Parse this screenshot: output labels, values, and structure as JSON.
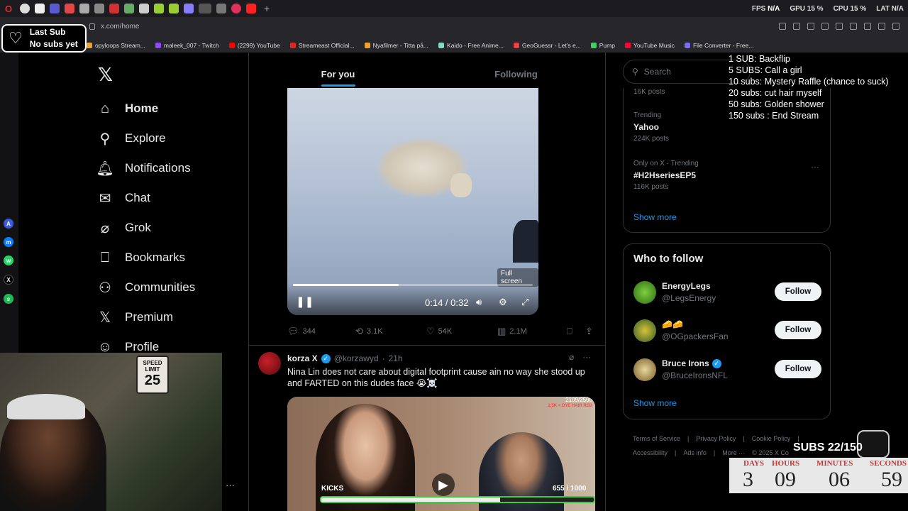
{
  "perf": {
    "fps_label": "FPS",
    "fps_val": "N/A",
    "gpu_label": "GPU",
    "gpu_val": "15 %",
    "cpu_label": "CPU",
    "cpu_val": "15 %",
    "lat_label": "LAT",
    "lat_val": "N/A"
  },
  "browser": {
    "url": "x.com/home"
  },
  "bookmarks": [
    {
      "label": "opyloops Stream...",
      "color": "#e8a33a"
    },
    {
      "label": "maleek_007 - Twitch",
      "color": "#9146ff"
    },
    {
      "label": "(2299) YouTube",
      "color": "#ff0000"
    },
    {
      "label": "Streameast Official...",
      "color": "#e02424"
    },
    {
      "label": "Nyafilmer - Titta på...",
      "color": "#f0a030"
    },
    {
      "label": "Kaido - Free Anime...",
      "color": "#7fdcc4"
    },
    {
      "label": "GeoGuessr - Let's e...",
      "color": "#e84040"
    },
    {
      "label": "Pump",
      "color": "#44cc66"
    },
    {
      "label": "YouTube Music",
      "color": "#ff0033"
    },
    {
      "label": "File Converter - Free...",
      "color": "#7a6cf0"
    }
  ],
  "last_sub": {
    "line1": "Last Sub",
    "line2": "No subs yet"
  },
  "nav": {
    "items": [
      {
        "label": "Home",
        "icon": "home-icon"
      },
      {
        "label": "Explore",
        "icon": "search-icon"
      },
      {
        "label": "Notifications",
        "icon": "bell-icon"
      },
      {
        "label": "Chat",
        "icon": "mail-icon"
      },
      {
        "label": "Grok",
        "icon": "grok-icon"
      },
      {
        "label": "Bookmarks",
        "icon": "bookmark-icon"
      },
      {
        "label": "Communities",
        "icon": "communities-icon"
      },
      {
        "label": "Premium",
        "icon": "x-icon"
      },
      {
        "label": "Profile",
        "icon": "person-icon"
      }
    ]
  },
  "tabs": {
    "for_you": "For you",
    "following": "Following"
  },
  "video": {
    "tooltip": "Full screen",
    "time": "0:14 / 0:32",
    "progress": 0.44
  },
  "tweet1": {
    "replies": "344",
    "reposts": "3.1K",
    "likes": "54K",
    "views": "2.1M"
  },
  "tweet2": {
    "name": "korza X",
    "handle": "@korzawyd",
    "time": "21h",
    "text": "Nina Lin does not care about digital footprint cause ain no way she stood up and FARTED on this dudes face 😭☠️",
    "media_top": "2109/2500",
    "media_red": "2.5K = DYE HAIR RED",
    "kicks_label": "KICKS",
    "kicks_count": "655 / 1000",
    "kicks_progress": 0.655
  },
  "right": {
    "search_placeholder": "Search",
    "trend0_posts": "16K posts",
    "trend1_meta": "Trending",
    "trend1_name": "Yahoo",
    "trend1_posts": "224K posts",
    "trend2_meta": "Only on X · Trending",
    "trend2_name": "#H2HseriesEP5",
    "trend2_posts": "116K posts",
    "show_more": "Show more",
    "who_to_follow": "Who to follow",
    "follow": [
      {
        "name": "EnergyLegs",
        "handle": "@LegsEnergy",
        "btn": "Follow"
      },
      {
        "name": "🧀🧀",
        "handle": "@OGpackersFan",
        "btn": "Follow"
      },
      {
        "name": "Bruce Irons",
        "handle": "@BruceIronsNFL",
        "btn": "Follow"
      }
    ],
    "show_more2": "Show more",
    "footer": [
      "Terms of Service",
      "|",
      "Privacy Policy",
      "|",
      "Cookie Policy",
      "|",
      "Accessibility",
      "|",
      "Ads info",
      "|",
      "More ···",
      "© 2025 X Co"
    ]
  },
  "overlay": {
    "goals": [
      "1 SUB: Backflip",
      "5 SUBS: Call a girl",
      "10 subs: Mystery Raffle (chance to suck)",
      "20 subs: cut hair myself",
      "50 subs: Golden shower",
      "150 subs : End Stream"
    ],
    "subs": "SUBS 22/150",
    "countdown": [
      {
        "label": "DAYS",
        "value": "3"
      },
      {
        "label": "HOURS",
        "value": "09"
      },
      {
        "label": "MINUTES",
        "value": "06"
      },
      {
        "label": "SECONDS",
        "value": "59"
      }
    ]
  },
  "cam": {
    "sign_top": "SPEED LIMIT",
    "sign_num": "25"
  }
}
